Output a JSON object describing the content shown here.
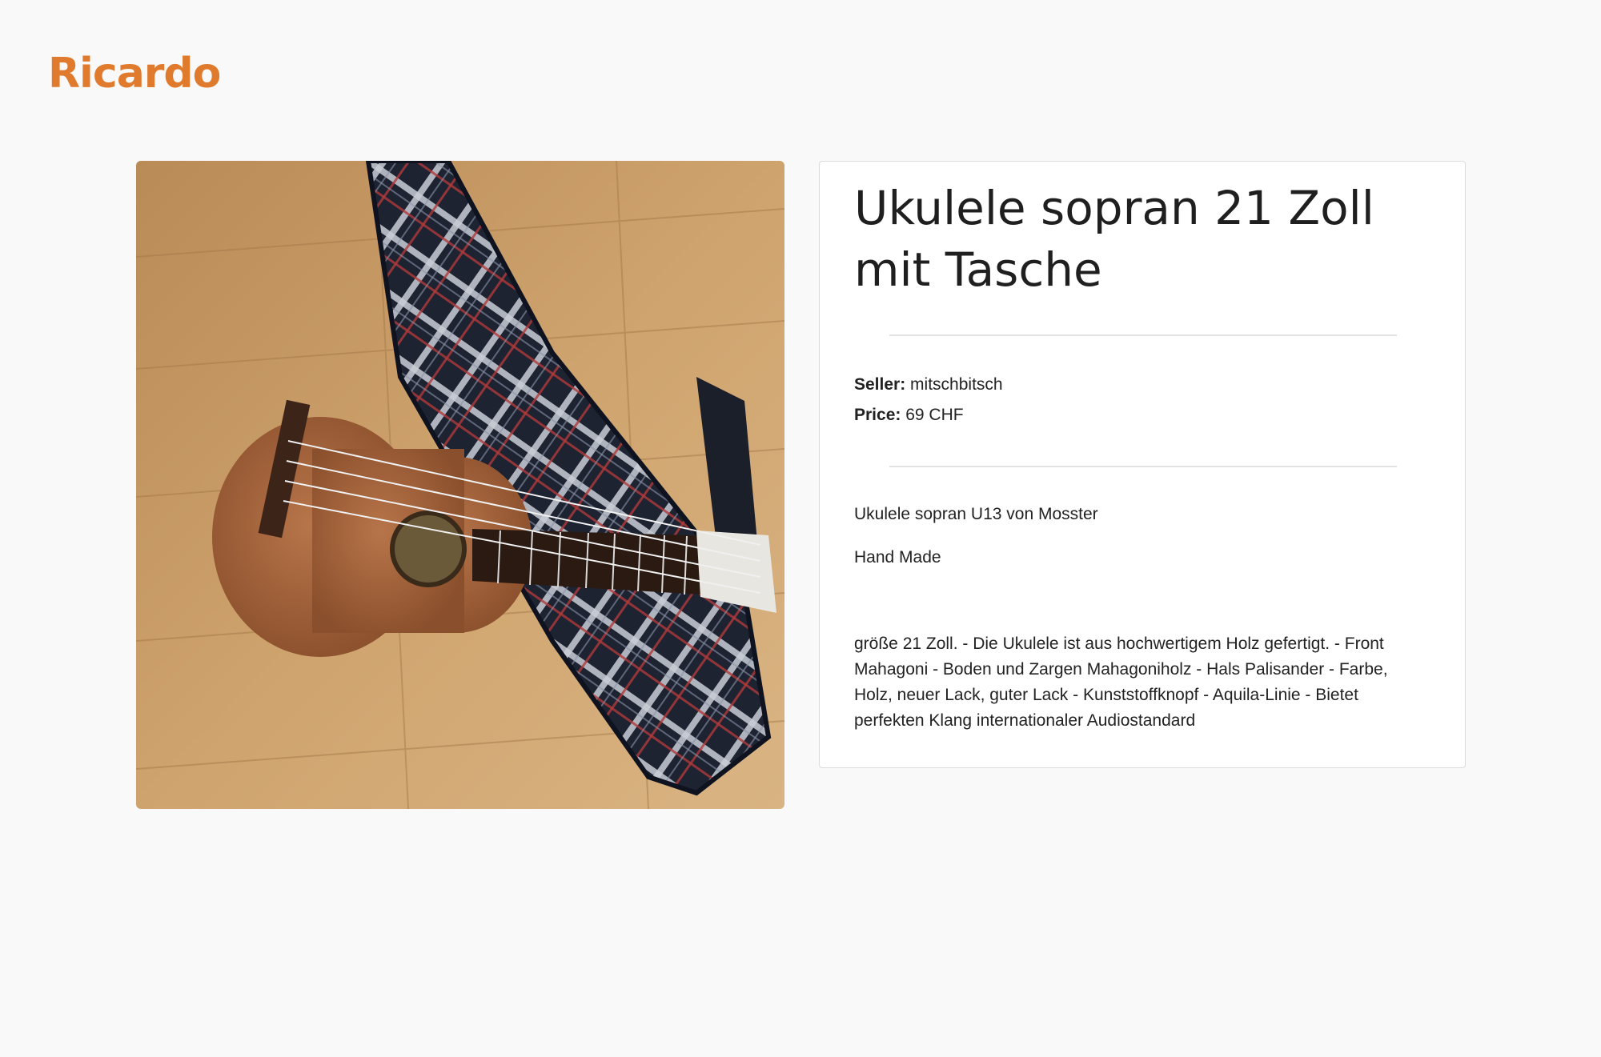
{
  "brand": {
    "logo_text": "Ricardo",
    "color": "#e07b2e"
  },
  "product": {
    "image_alt": "ukulele-with-plaid-case-photo",
    "title": "Ukulele sopran 21 Zoll mit Tasche",
    "seller_label": "Seller:",
    "seller": "mitschbitsch",
    "price_label": "Price:",
    "price": "69 CHF",
    "description": {
      "line1": "Ukulele sopran U13 von Mosster",
      "line2": "Hand Made",
      "paragraph": "größe 21 Zoll. - Die Ukulele ist aus hochwertigem Holz gefertigt. - Front Mahagoni - Boden und Zargen Mahagoniholz - Hals Palisander - Farbe, Holz, neuer Lack, guter Lack - Kunststoffknopf - Aquila-Linie - Bietet perfekten Klang internationaler Audiostandard"
    }
  }
}
